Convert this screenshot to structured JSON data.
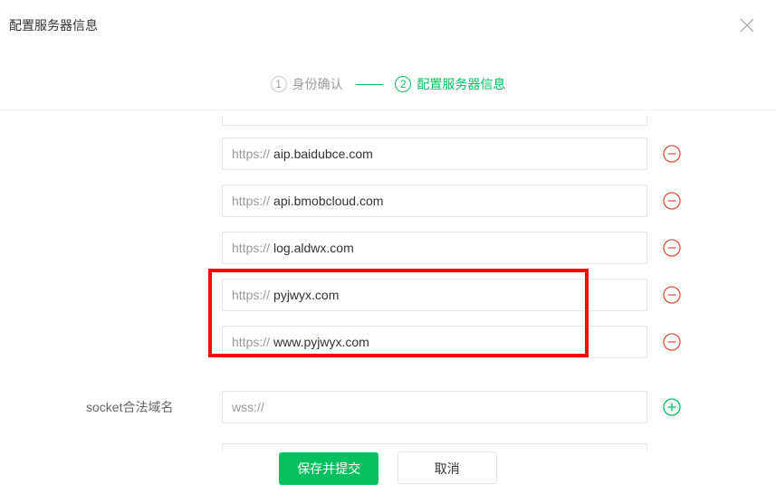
{
  "header": {
    "title": "配置服务器信息"
  },
  "steps": {
    "step1_num": "①",
    "step1_label": "身份确认",
    "step2_num": "②",
    "step2_label": "配置服务器信息"
  },
  "prefixes": {
    "https": "https://",
    "wss": "wss://"
  },
  "rows": [
    {
      "value": "aip.baidubce.com"
    },
    {
      "value": "api.bmobcloud.com"
    },
    {
      "value": "log.aldwx.com"
    },
    {
      "value": "pyjwyx.com"
    },
    {
      "value": "www.pyjwyx.com"
    }
  ],
  "socket": {
    "label": "socket合法域名",
    "value": ""
  },
  "buttons": {
    "save": "保存并提交",
    "cancel": "取消"
  }
}
